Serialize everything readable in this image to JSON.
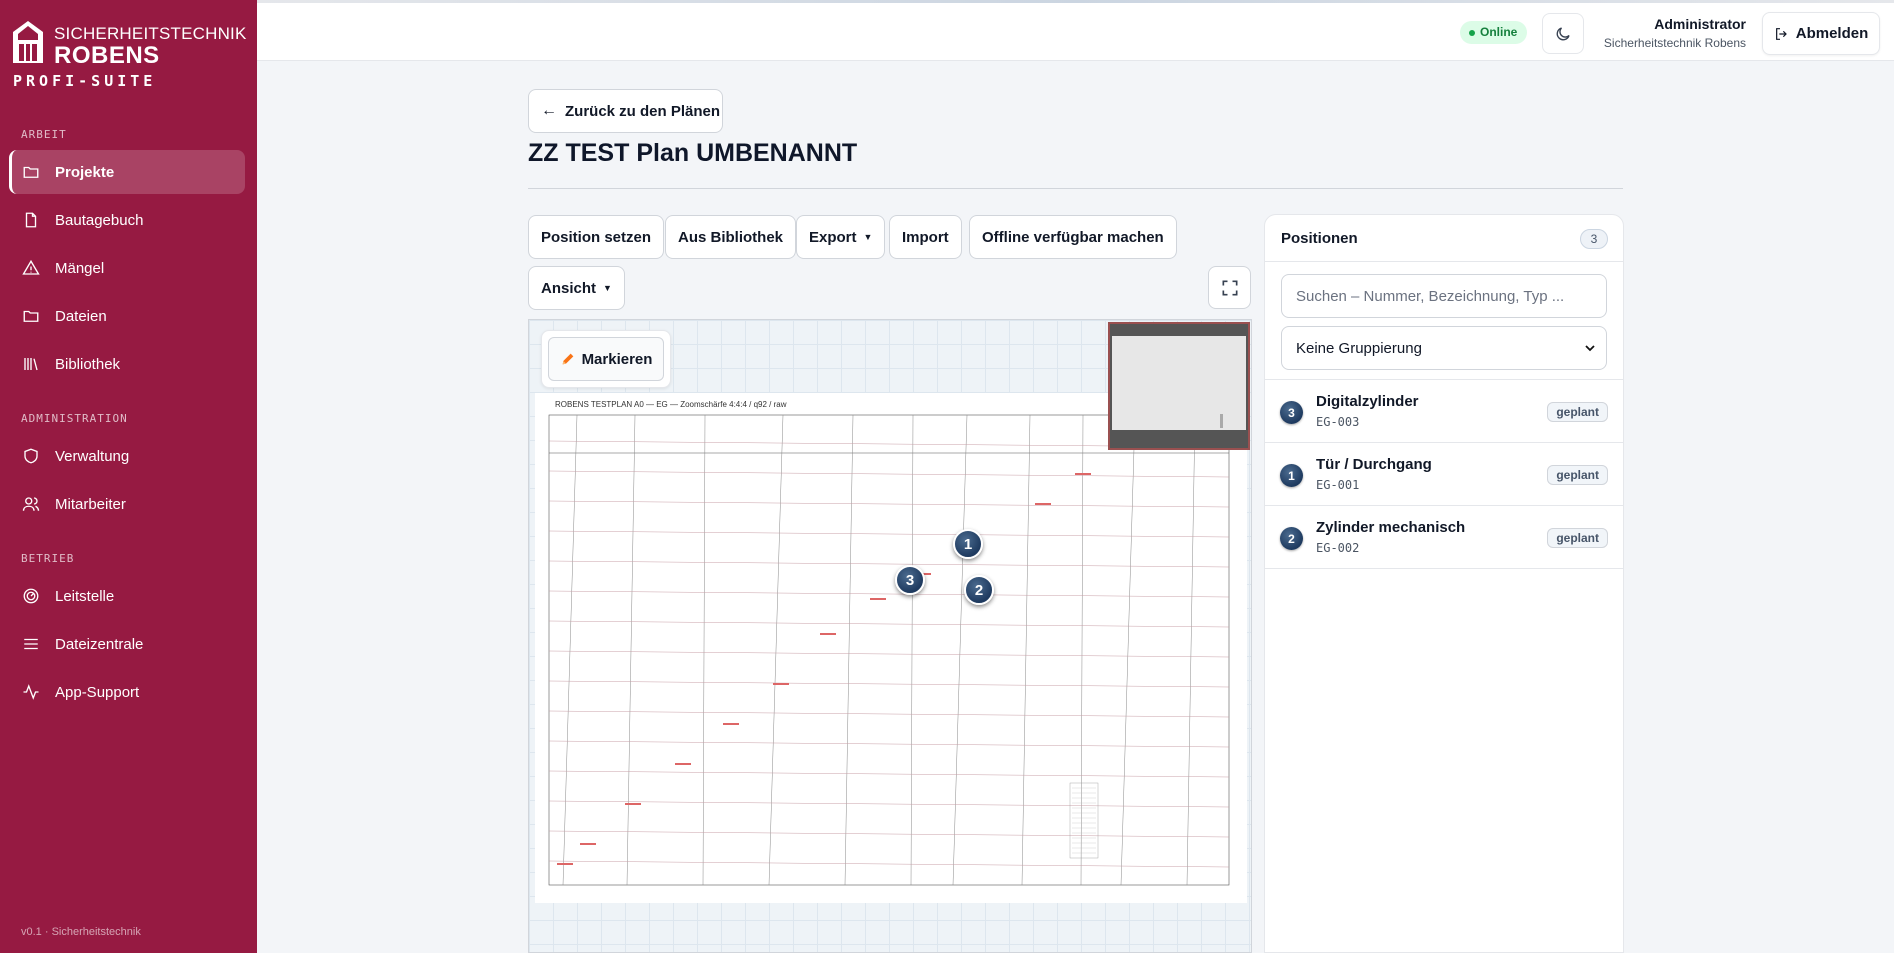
{
  "brand": {
    "line1": "SICHERHEITSTECHNIK",
    "line2": "ROBENS",
    "line3": "PROFI-SUITE"
  },
  "sidebar": {
    "sections": [
      {
        "label": "ARBEIT",
        "items": [
          {
            "label": "Projekte",
            "icon": "folder-icon",
            "active": true
          },
          {
            "label": "Bautagebuch",
            "icon": "file-icon"
          },
          {
            "label": "Mängel",
            "icon": "warning-icon"
          },
          {
            "label": "Dateien",
            "icon": "folder-icon"
          },
          {
            "label": "Bibliothek",
            "icon": "library-icon"
          }
        ]
      },
      {
        "label": "ADMINISTRATION",
        "items": [
          {
            "label": "Verwaltung",
            "icon": "shield-icon"
          },
          {
            "label": "Mitarbeiter",
            "icon": "users-icon"
          }
        ]
      },
      {
        "label": "BETRIEB",
        "items": [
          {
            "label": "Leitstelle",
            "icon": "gauge-icon"
          },
          {
            "label": "Dateizentrale",
            "icon": "menu-icon"
          },
          {
            "label": "App-Support",
            "icon": "activity-icon"
          }
        ]
      }
    ],
    "version": "v0.1 · Sicherheitstechnik"
  },
  "header": {
    "status": "Online",
    "user_name": "Administrator",
    "user_org": "Sicherheitstechnik Robens",
    "logout_label": "Abmelden"
  },
  "main": {
    "back_label": "Zurück zu den Plänen",
    "title": "ZZ TEST Plan UMBENANNT",
    "toolbar": {
      "position_setzen": "Position setzen",
      "aus_bibliothek": "Aus Bibliothek",
      "export": "Export",
      "import": "Import",
      "offline": "Offline verfügbar machen",
      "ansicht": "Ansicht"
    },
    "viewer": {
      "markieren_label": "Markieren",
      "plan_caption": "ROBENS TESTPLAN A0 — EG — Zoomschärfe 4:4:4 / q92 / raw",
      "markers": [
        "1",
        "2",
        "3"
      ]
    }
  },
  "panel": {
    "title": "Positionen",
    "count": "3",
    "search_placeholder": "Suchen – Nummer, Bezeichnung, Typ ...",
    "grouping": "Keine Gruppierung",
    "positions": [
      {
        "num": "3",
        "name": "Digitalzylinder",
        "code": "EG-003",
        "status": "geplant"
      },
      {
        "num": "1",
        "name": "Tür / Durchgang",
        "code": "EG-001",
        "status": "geplant"
      },
      {
        "num": "2",
        "name": "Zylinder mechanisch",
        "code": "EG-002",
        "status": "geplant"
      }
    ]
  },
  "colors": {
    "sidebar_bg": "#961a42",
    "marker": "#1e3a5f",
    "online_bg": "#dcfce7"
  }
}
